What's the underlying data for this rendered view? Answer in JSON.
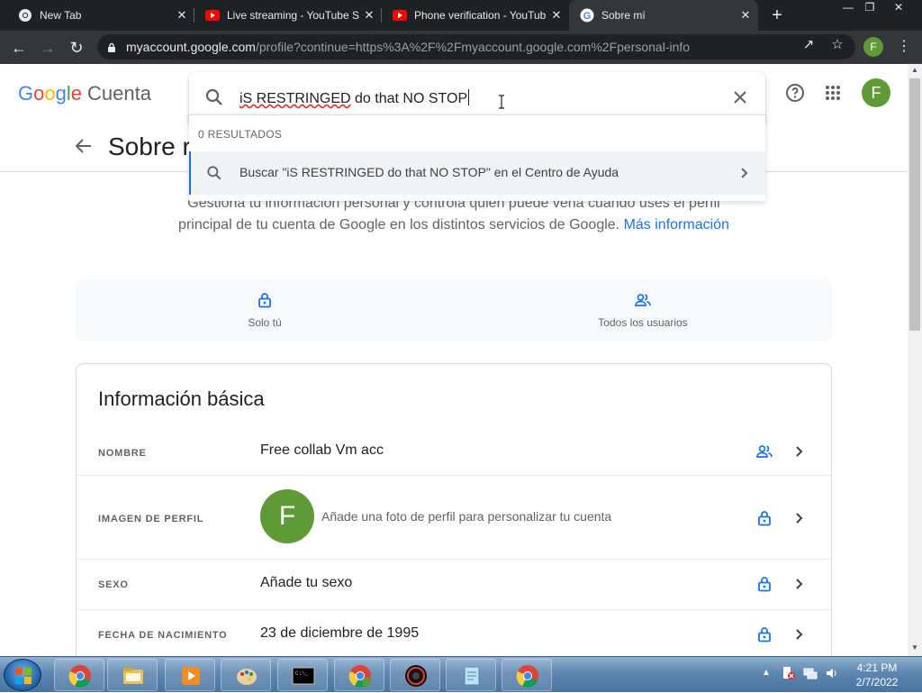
{
  "browser": {
    "tabs": [
      {
        "title": "New Tab",
        "icon": "chrome-icon",
        "active": false
      },
      {
        "title": "Live streaming - YouTube S",
        "icon": "youtube-icon",
        "active": false
      },
      {
        "title": "Phone verification - YouTub",
        "icon": "youtube-icon",
        "active": false
      },
      {
        "title": "Sobre mí",
        "icon": "google-icon",
        "active": true
      }
    ],
    "new_tab": "+",
    "url_host": "myaccount.google.com",
    "url_path": "/profile?continue=https%3A%2F%2Fmyaccount.google.com%2Fpersonal-info",
    "profile_initial": "F"
  },
  "header": {
    "logo_google": "Google",
    "logo_product": "Cuenta",
    "avatar_initial": "F"
  },
  "search": {
    "query_misspelled": "iS RESTRINGED",
    "query_rest": " do that NO STOP",
    "results_count": "0 RESULTADOS",
    "help_result": "Buscar \"iS RESTRINGED do that NO STOP\" en el Centro de Ayuda"
  },
  "page": {
    "title": "Sobre r",
    "intro": "Gestiona tu información personal y controla quién puede verla cuando uses el perfil principal de tu cuenta de Google en los distintos servicios de Google.",
    "more_link": "Más información"
  },
  "visibility": [
    {
      "label": "Solo tú",
      "icon": "lock-icon"
    },
    {
      "label": "Todos los usuarios",
      "icon": "people-icon"
    }
  ],
  "basic_info": {
    "title": "Información básica",
    "rows": [
      {
        "label": "NOMBRE",
        "value": "Free collab Vm acc",
        "icon": "people-icon"
      },
      {
        "label": "IMAGEN DE PERFIL",
        "value": "Añade una foto de perfil para personalizar tu cuenta",
        "avatar": "F",
        "icon": "lock-icon"
      },
      {
        "label": "SEXO",
        "value": "Añade tu sexo",
        "icon": "lock-icon"
      },
      {
        "label": "FECHA DE NACIMIENTO",
        "value": "23 de diciembre de 1995",
        "icon": "lock-icon"
      }
    ]
  },
  "taskbar": {
    "time": "4:21 PM",
    "date": "2/7/2022",
    "apps": [
      "chrome-icon",
      "explorer-icon",
      "media-player-icon",
      "paint-icon",
      "cmd-icon",
      "chrome-profile-icon",
      "obs-icon",
      "notepad-icon",
      "chrome-icon"
    ]
  },
  "colors": {
    "accent": "#1a73e8",
    "avatar": "#5f9a36",
    "tabbar": "#202124",
    "toolbar": "#35363a"
  }
}
